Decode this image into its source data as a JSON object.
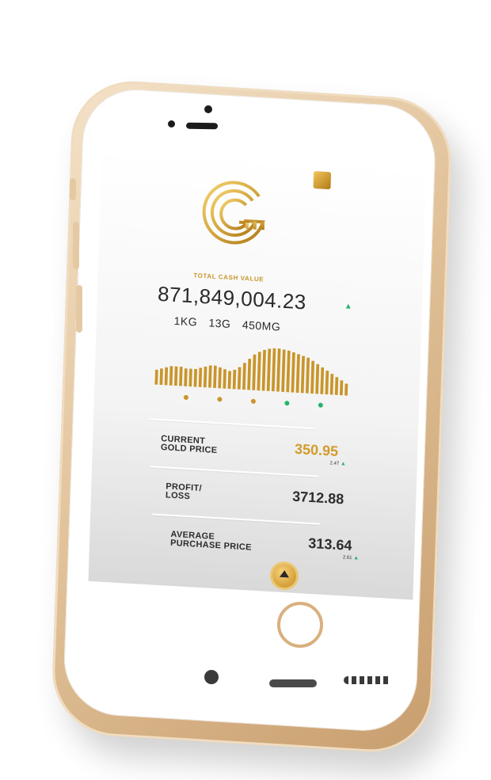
{
  "header": {
    "total_label": "TOTAL CASH VALUE",
    "total_value": "871,849,004.23",
    "trend_icon": "up-triangle-icon"
  },
  "holdings": [
    "1KG",
    "13G",
    "450MG"
  ],
  "chart_data": {
    "type": "area",
    "x": [
      1,
      2,
      3,
      4,
      5,
      6,
      7,
      8,
      9,
      10,
      11,
      12,
      13,
      14,
      15,
      16,
      17,
      18,
      19,
      20,
      21,
      22,
      23,
      24,
      25,
      26,
      27,
      28,
      29,
      30,
      31,
      32,
      33,
      34,
      35,
      36,
      37,
      38,
      39,
      40
    ],
    "values": [
      10,
      11,
      12,
      13,
      13,
      13,
      12,
      12,
      12,
      13,
      14,
      15,
      15,
      14,
      13,
      12,
      13,
      15,
      18,
      21,
      24,
      26,
      27.5,
      28.5,
      29,
      29,
      28.5,
      28,
      27,
      26,
      25,
      24,
      22,
      20,
      18,
      16,
      14,
      12,
      10,
      8
    ],
    "ylim": [
      0,
      32
    ],
    "page_dots": [
      {
        "color": "#c9952a"
      },
      {
        "color": "#c9952a"
      },
      {
        "color": "#c9952a"
      },
      {
        "color": "#27b46b"
      },
      {
        "color": "#27b46b"
      }
    ]
  },
  "metrics": [
    {
      "label_line1": "CURRENT",
      "label_line2": "GOLD PRICE",
      "value": "350.95",
      "change": "2.47"
    },
    {
      "label_line1": "PROFIT/",
      "label_line2": "LOSS",
      "value": "3712.88"
    },
    {
      "label_line1": "AVERAGE",
      "label_line2": "PURCHASE PRICE",
      "value": "313.64",
      "change": "2.61"
    }
  ],
  "colors": {
    "gold": "#c9952a",
    "up_green": "#27b46b",
    "text_dark": "#2a2a2a"
  },
  "icons": {
    "menu": "menu-square-icon",
    "logo": "g-logo-icon",
    "scroll_up": "up-arrow-icon"
  }
}
